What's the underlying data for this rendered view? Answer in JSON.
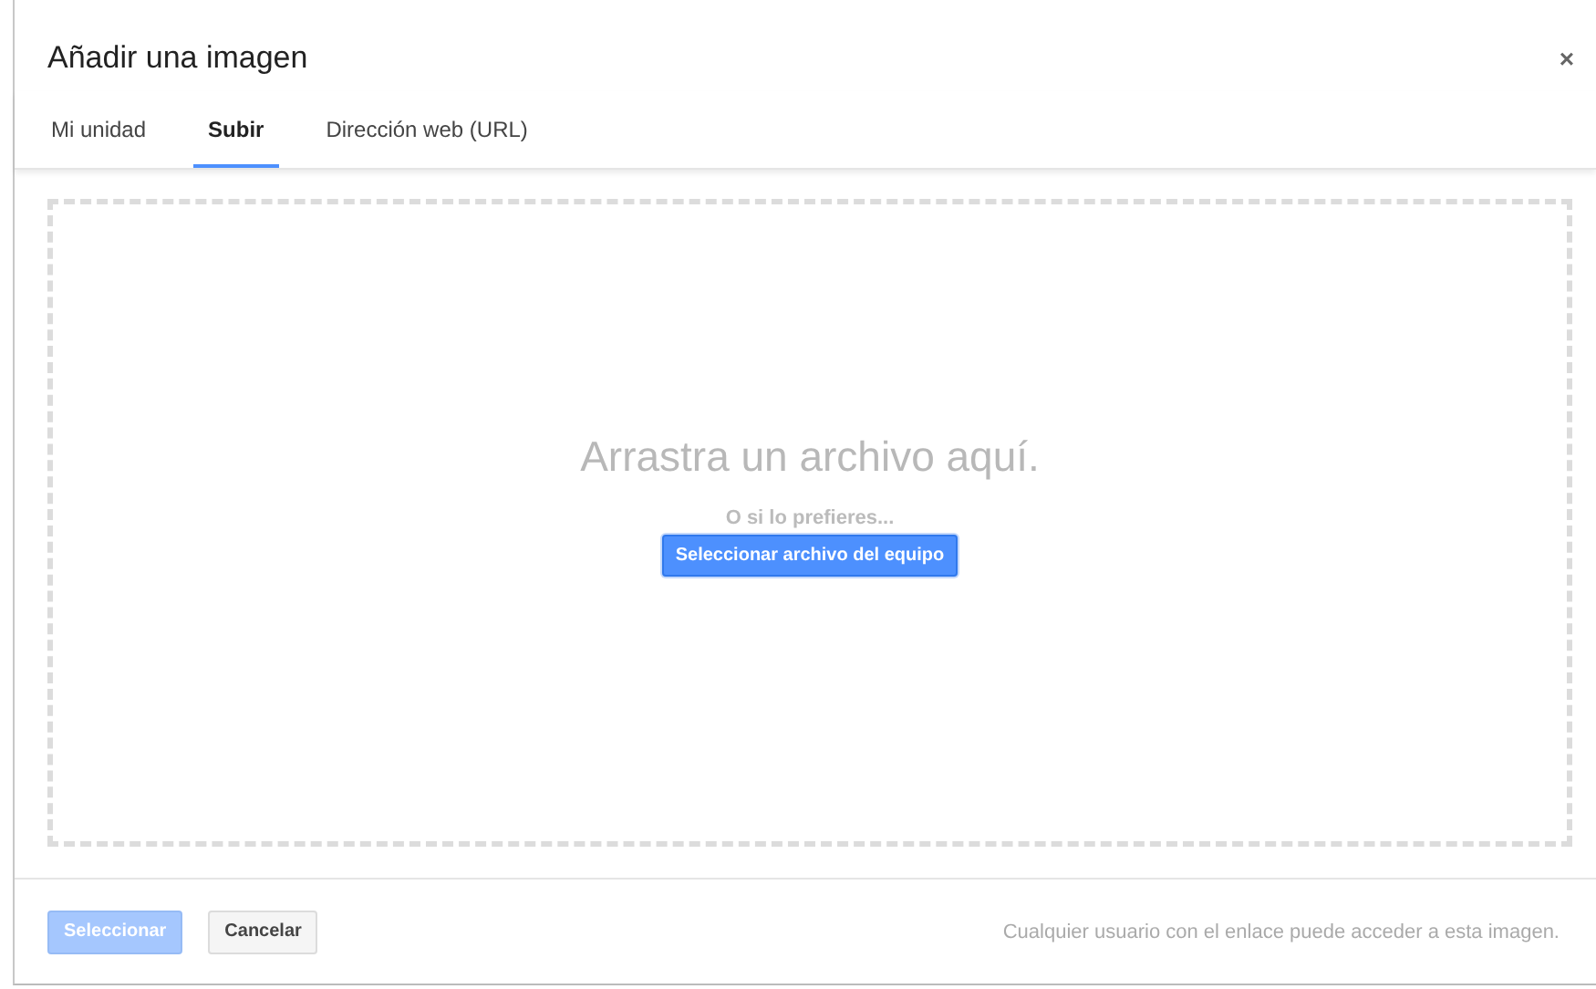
{
  "dialog": {
    "title": "Añadir una imagen",
    "close": "×"
  },
  "tabs": [
    {
      "label": "Mi unidad",
      "selected": false
    },
    {
      "label": "Subir",
      "selected": true
    },
    {
      "label": "Dirección web (URL)",
      "selected": false
    }
  ],
  "drop_zone": {
    "heading": "Arrastra un archivo aquí.",
    "hint": "O si lo prefieres...",
    "button": "Seleccionar archivo del equipo"
  },
  "footer": {
    "buttons": [
      {
        "label": "Seleccionar",
        "kind": "primary",
        "disabled": true
      },
      {
        "label": "Cancelar",
        "kind": "secondary",
        "disabled": false
      }
    ],
    "note": "Cualquier usuario con el enlace puede acceder a esta imagen."
  }
}
